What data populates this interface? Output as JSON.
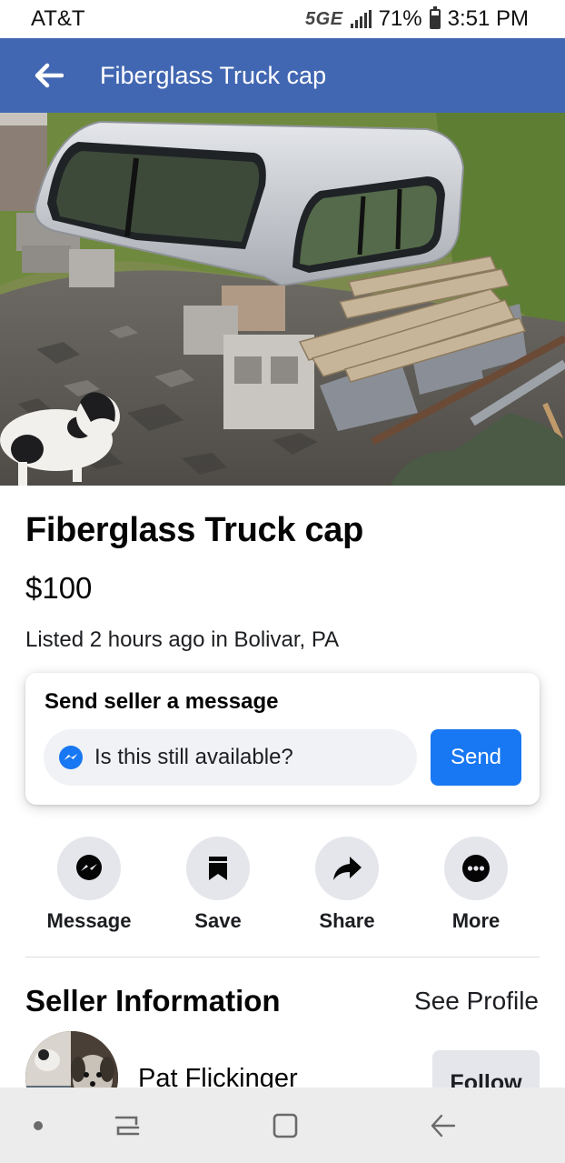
{
  "status_bar": {
    "carrier": "AT&T",
    "network": "5GE",
    "battery": "71%",
    "battery_level": 0.71,
    "time": "3:51 PM"
  },
  "app_bar": {
    "title": "Fiberglass Truck cap"
  },
  "listing": {
    "title": "Fiberglass Truck cap",
    "price": "$100",
    "listed": "Listed 2 hours ago in Bolivar, PA"
  },
  "message_card": {
    "title": "Send seller a message",
    "input_value": "Is this still available?",
    "send_label": "Send"
  },
  "actions": [
    {
      "label": "Message",
      "icon": "messenger-icon"
    },
    {
      "label": "Save",
      "icon": "bookmark-icon"
    },
    {
      "label": "Share",
      "icon": "share-arrow-icon"
    },
    {
      "label": "More",
      "icon": "more-dots-icon"
    }
  ],
  "seller": {
    "heading": "Seller Information",
    "see_profile": "See Profile",
    "name": "Pat Flickinger",
    "follow_label": "Follow"
  },
  "colors": {
    "app_bar": "#4267b2",
    "primary": "#1877f2",
    "button_bg": "#e4e6eb",
    "nav_bar": "#ececec"
  }
}
